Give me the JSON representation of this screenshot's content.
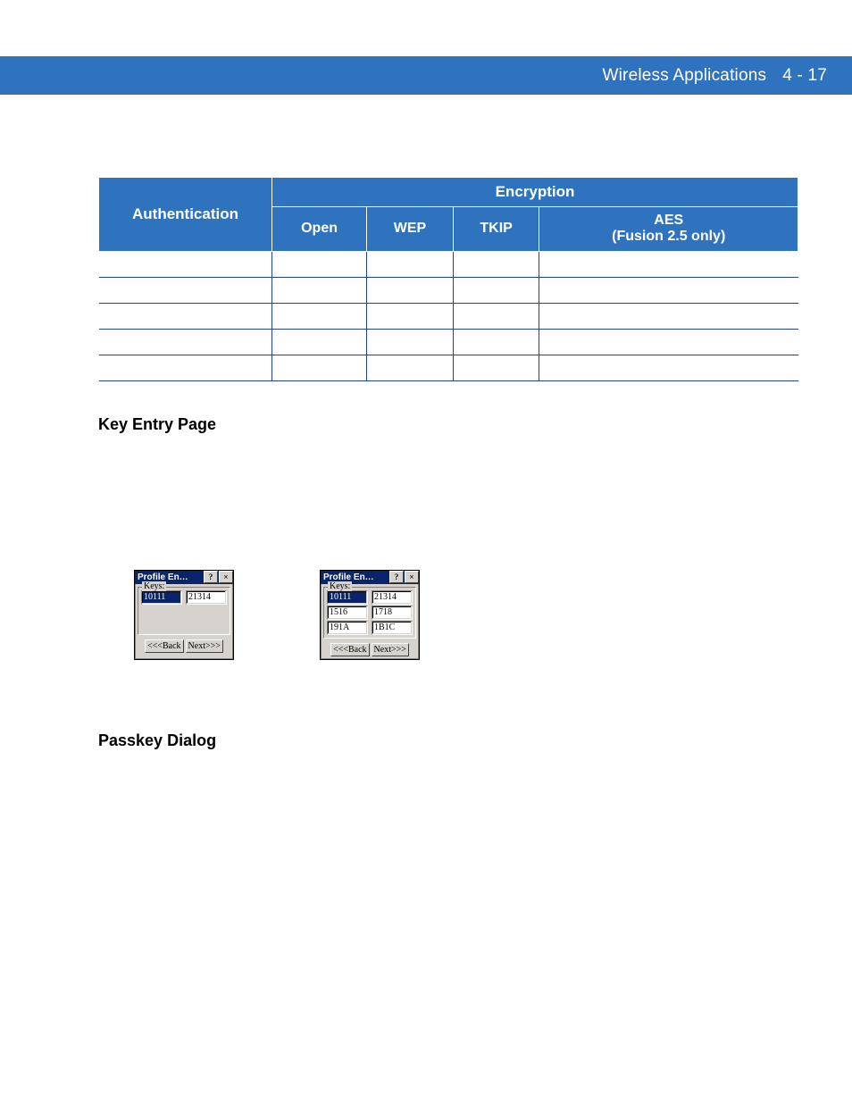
{
  "header": {
    "title": "Wireless Applications",
    "pageno": "4 - 17"
  },
  "table": {
    "encryption_label": "Encryption",
    "auth_label": "Authentication",
    "cols": [
      "Open",
      "WEP",
      "TKIP",
      "AES\n(Fusion 2.5 only)"
    ],
    "rows": 5
  },
  "sections": {
    "key_entry": "Key Entry Page",
    "passkey": "Passkey Dialog"
  },
  "dialog": {
    "title": "Profile En…",
    "help": "?",
    "close": "×",
    "group": "Keys:",
    "back": "<<<Back",
    "next": "Next>>>",
    "left": {
      "rows": [
        [
          "10111",
          "21314"
        ]
      ]
    },
    "right": {
      "rows": [
        [
          "10111",
          "21314"
        ],
        [
          "1516",
          "1718"
        ],
        [
          "191A",
          "1B1C"
        ]
      ]
    }
  }
}
